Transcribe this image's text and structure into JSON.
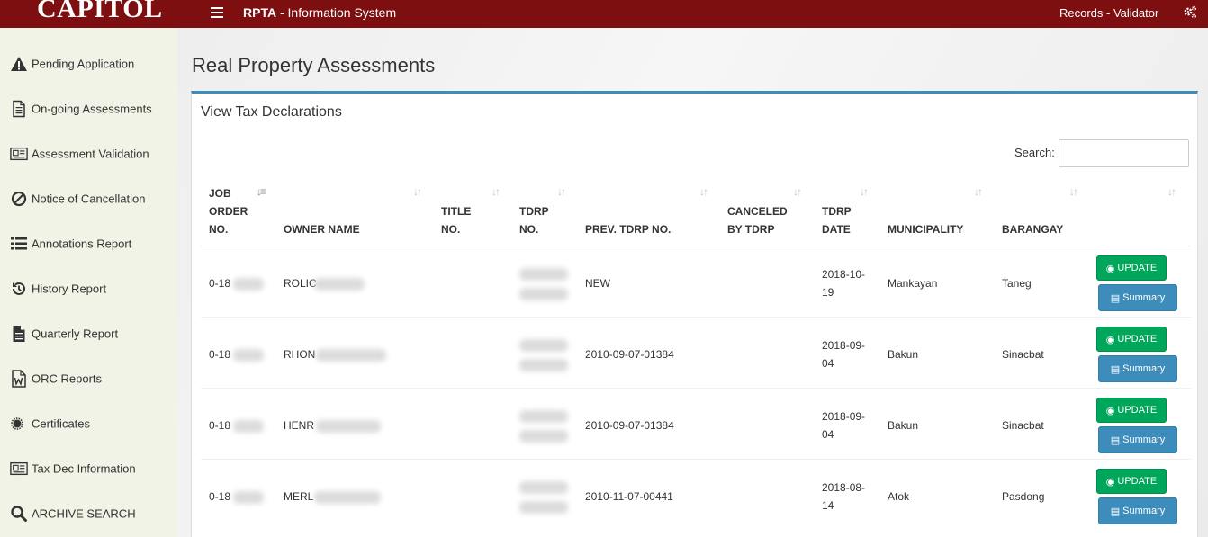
{
  "topbar": {
    "brand": "CAPITOL",
    "app_code": "RPTA",
    "app_subtitle": " - Information System",
    "user_role": "Records - Validator"
  },
  "sidebar": {
    "items": [
      {
        "label": "Pending Application",
        "icon": "warning-icon"
      },
      {
        "label": "On-going Assessments",
        "icon": "document-icon"
      },
      {
        "label": "Assessment Validation",
        "icon": "newspaper-icon"
      },
      {
        "label": "Notice of Cancellation",
        "icon": "ban-icon"
      },
      {
        "label": "Annotations Report",
        "icon": "list-icon"
      },
      {
        "label": "History Report",
        "icon": "history-icon"
      },
      {
        "label": "Quarterly Report",
        "icon": "file-text-icon"
      },
      {
        "label": "ORC Reports",
        "icon": "word-file-icon"
      },
      {
        "label": "Certificates",
        "icon": "certificate-icon"
      },
      {
        "label": "Tax Dec Information",
        "icon": "newspaper-icon"
      },
      {
        "label": "ARCHIVE SEARCH",
        "icon": "search-icon"
      }
    ]
  },
  "main": {
    "page_title": "Real Property Assessments",
    "box_title": "View Tax Declarations",
    "search_label": "Search:",
    "search_value": ""
  },
  "table": {
    "headers": {
      "job_order": [
        "JOB",
        "ORDER",
        "NO."
      ],
      "owner": "OWNER NAME",
      "title": [
        "TITLE",
        "NO."
      ],
      "tdrp": [
        "TDRP",
        "NO."
      ],
      "prev": "PREV. TDRP NO.",
      "canceled": [
        "CANCELED",
        "BY TDRP"
      ],
      "date": [
        "TDRP",
        "DATE"
      ],
      "municipality": "MUNICIPALITY",
      "barangay": "BARANGAY"
    },
    "rows": [
      {
        "job": "0-18",
        "owner": "ROLIC",
        "prev": "NEW",
        "date": [
          "2018-10-",
          "19"
        ],
        "municipality": "Mankayan",
        "barangay": "Taneg"
      },
      {
        "job": "0-18",
        "owner": "RHON",
        "prev": "2010-09-07-01384",
        "date": [
          "2018-09-",
          "04"
        ],
        "municipality": "Bakun",
        "barangay": "Sinacbat"
      },
      {
        "job": "0-18",
        "owner": "HENR",
        "prev": "2010-09-07-01384",
        "date": [
          "2018-09-",
          "04"
        ],
        "municipality": "Bakun",
        "barangay": "Sinacbat"
      },
      {
        "job": "0-18",
        "owner": "MERL",
        "prev": "2010-11-07-00441",
        "date": [
          "2018-08-",
          "14"
        ],
        "municipality": "Atok",
        "barangay": "Pasdong"
      }
    ],
    "update_label": "UPDATE",
    "summary_label": "Summary"
  }
}
